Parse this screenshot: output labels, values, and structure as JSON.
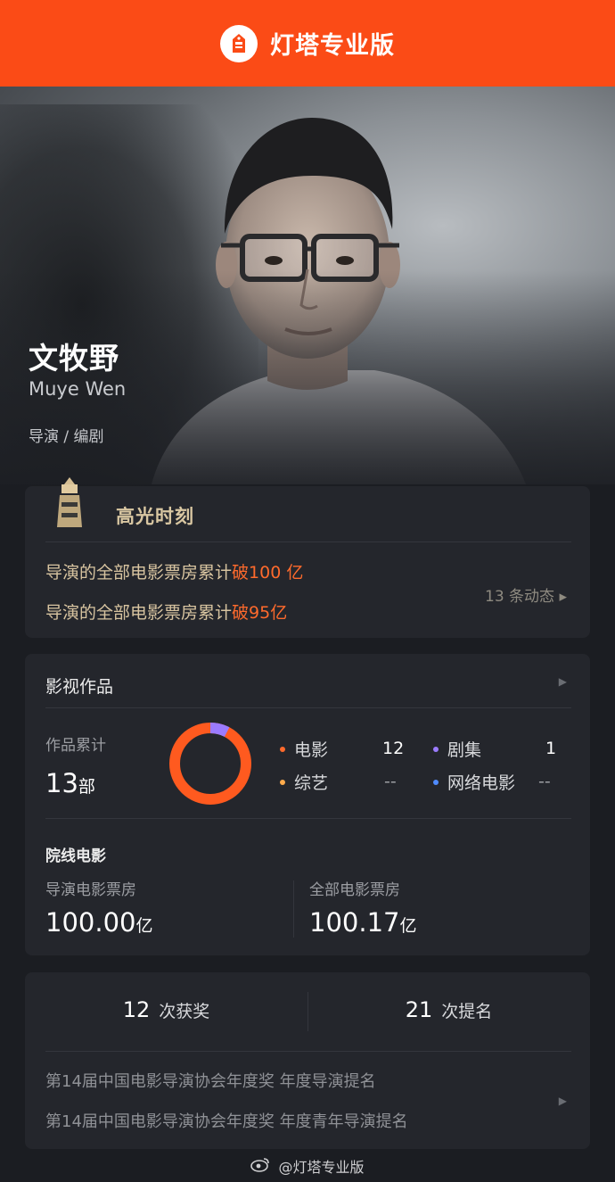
{
  "header": {
    "app_title": "灯塔专业版"
  },
  "person": {
    "name_cn": "文牧野",
    "name_en": "Muye Wen",
    "roles": "导演 / 编剧"
  },
  "highlights": {
    "title": "高光时刻",
    "items": [
      {
        "prefix": "导演的全部电影票房累计",
        "highlight": "破100 亿"
      },
      {
        "prefix": "导演的全部电影票房累计",
        "highlight": "破95亿"
      }
    ],
    "more_label": "13 条动态 ▸"
  },
  "works": {
    "title": "影视作品",
    "total_label": "作品累计",
    "total_value": "13",
    "total_unit": "部",
    "donut": {
      "movie_fraction": 0.923,
      "series_fraction": 0.077,
      "movie_color": "#ff5a1f",
      "series_color": "#9b7bff"
    },
    "legend": [
      {
        "name": "电影",
        "value": "12",
        "color": "#ff6a2c"
      },
      {
        "name": "剧集",
        "value": "1",
        "color": "#9b7bff"
      },
      {
        "name": "综艺",
        "value": "--",
        "color": "#ffab4c"
      },
      {
        "name": "网络电影",
        "value": "--",
        "color": "#4f8bff"
      }
    ],
    "theater_title": "院线电影",
    "director_box_label": "导演电影票房",
    "director_box_value": "100.00",
    "all_box_label": "全部电影票房",
    "all_box_value": "100.17",
    "box_unit": "亿"
  },
  "awards": {
    "wins_count": "12",
    "wins_label": "次获奖",
    "nominations_count": "21",
    "nominations_label": "次提名",
    "lines": [
      "第14届中国电影导演协会年度奖 年度导演提名",
      "第14届中国电影导演协会年度奖 年度青年导演提名"
    ]
  },
  "footer": {
    "watermark": "@灯塔专业版"
  }
}
